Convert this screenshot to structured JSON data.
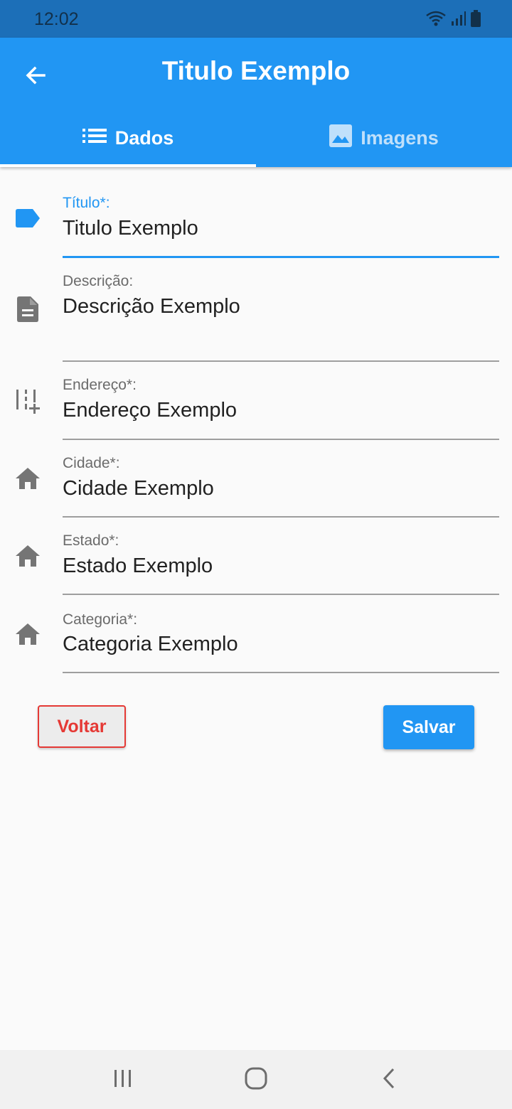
{
  "status_bar": {
    "time": "12:02",
    "icons": [
      "wifi-icon",
      "signal-icon",
      "battery-icon"
    ]
  },
  "app_bar": {
    "title": "Titulo Exemplo",
    "back_icon": "arrow-back-icon"
  },
  "tabs": [
    {
      "label": "Dados",
      "icon": "list-icon",
      "active": true
    },
    {
      "label": "Imagens",
      "icon": "image-icon",
      "active": false
    }
  ],
  "form": {
    "fields": [
      {
        "label": "Título*:",
        "value": "Titulo Exemplo",
        "icon": "label-tag-icon",
        "focused": true
      },
      {
        "label": "Descrição:",
        "value": "Descrição Exemplo",
        "icon": "document-icon",
        "focused": false
      },
      {
        "label": "Endereço*:",
        "value": "Endereço Exemplo",
        "icon": "add-road-icon",
        "focused": false
      },
      {
        "label": "Cidade*:",
        "value": "Cidade Exemplo",
        "icon": "home-icon",
        "focused": false
      },
      {
        "label": "Estado*:",
        "value": "Estado Exemplo",
        "icon": "home-icon",
        "focused": false
      },
      {
        "label": "Categoria*:",
        "value": "Categoria Exemplo",
        "icon": "home-icon",
        "focused": false
      }
    ]
  },
  "buttons": {
    "back_label": "Voltar",
    "save_label": "Salvar"
  },
  "navigation_bar": {
    "items": [
      "recents-icon",
      "home-circle-icon",
      "back-chevron-icon"
    ]
  },
  "colors": {
    "primary": "#2196f3",
    "status_bar": "#1c6fb8",
    "danger": "#e53935",
    "background": "#fafafa"
  }
}
